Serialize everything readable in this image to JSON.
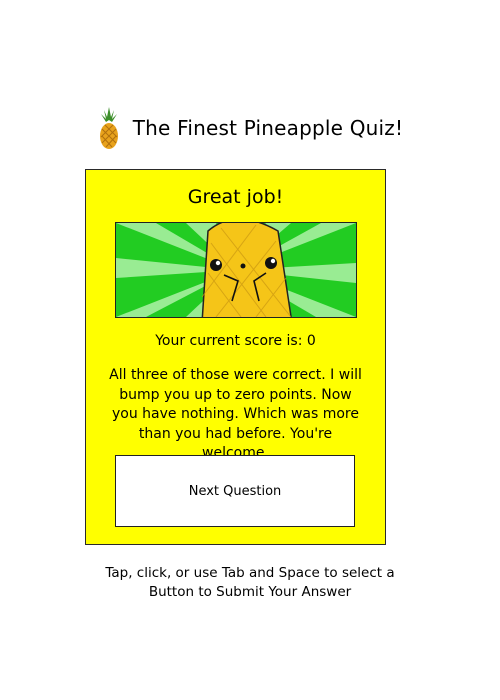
{
  "header": {
    "title": "The Finest Pineapple Quiz!",
    "logo_icon": "pineapple-icon"
  },
  "result": {
    "heading": "Great job!",
    "image_icon": "pineapple-character-icon",
    "score_line": "Your current score is: 0",
    "message": "All three of those were correct. I will bump you up to zero points. Now you have nothing. Which was more than you had before. You're welcome."
  },
  "buttons": {
    "next_label": "Next Question"
  },
  "footer": {
    "instructions_line1": "Tap, click, or use Tab and Space to select a",
    "instructions_line2": "Button to Submit Your Answer"
  },
  "colors": {
    "card_background": "#ffff00",
    "image_background": "#22cc22",
    "pineapple_body": "#f5c518",
    "page_background": "#ffffff"
  }
}
